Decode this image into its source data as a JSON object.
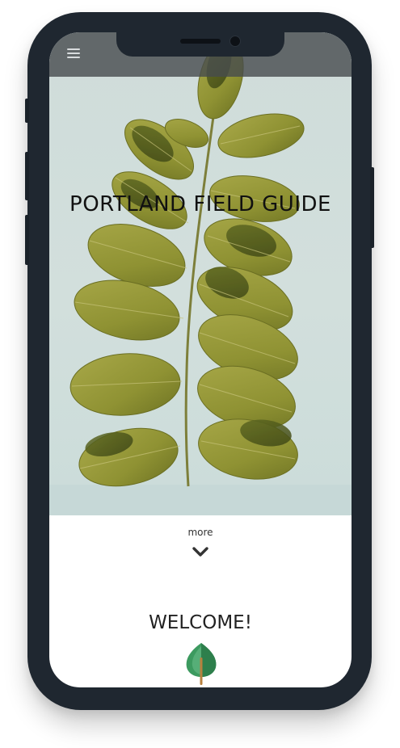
{
  "hero": {
    "title": "PORTLAND FIELD GUIDE"
  },
  "nav": {
    "menu_icon": "hamburger-menu-icon"
  },
  "content": {
    "more_label": "more",
    "more_icon": "chevron-down-icon",
    "welcome_heading": "WELCOME!",
    "welcome_icon": "tree-icon"
  },
  "colors": {
    "hero_background": "#cfdcda",
    "leaf": "#9a9a3a",
    "device_frame": "#1f2730",
    "tree_green": "#3c9a5f"
  }
}
